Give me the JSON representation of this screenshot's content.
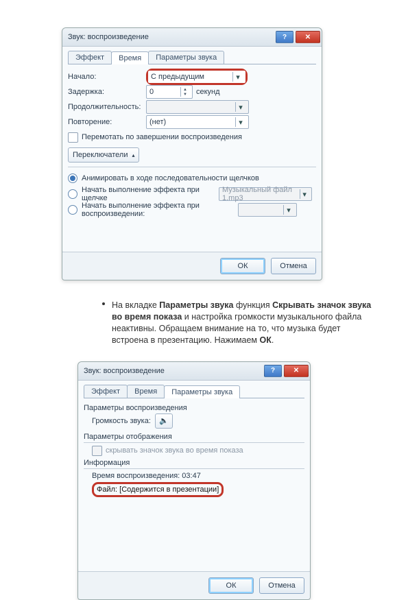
{
  "dlg1": {
    "title": "Звук: воспроизведение",
    "tabs": {
      "effect": "Эффект",
      "time": "Время",
      "params": "Параметры звука"
    },
    "start_label": "Начало:",
    "start_value": "С предыдущим",
    "delay_label": "Задержка:",
    "delay_value": "0",
    "delay_unit": "секунд",
    "duration_label": "Продолжительность:",
    "repeat_label": "Повторение:",
    "repeat_value": "(нет)",
    "rewind_label": "Перемотать по завершении воспроизведения",
    "switches_label": "Переключатели",
    "rad1": "Анимировать в ходе последовательности щелчков",
    "rad2": "Начать выполнение эффекта при щелчке",
    "rad2_value": "Музыкальный файл 1.mp3",
    "rad3": "Начать выполнение эффекта при воспроизведении:",
    "ok": "ОК",
    "cancel": "Отмена"
  },
  "bullet": {
    "t1": "На вкладке ",
    "b1": "Параметры звука",
    "t2": " функция ",
    "b2": "Скрывать значок звука во время показа",
    "t3": " и настройка громкости музыкального файла неактивны. Обращаем внимание на то, что музыка будет встроена в презентацию. Нажимаем ",
    "b3": "ОК",
    "t4": "."
  },
  "dlg2": {
    "title": "Звук: воспроизведение",
    "tabs": {
      "effect": "Эффект",
      "time": "Время",
      "params": "Параметры звука"
    },
    "group_play": "Параметры воспроизведения",
    "vol_label": "Громкость звука:",
    "group_disp": "Параметры отображения",
    "hide_label": "скрывать значок звука во время показа",
    "group_info": "Информация",
    "dur_label": "Время воспроизведения: ",
    "dur_value": "03:47",
    "file_label": "Файл: ",
    "file_value": "[Содержится в презентации]",
    "ok": "ОК",
    "cancel": "Отмена"
  }
}
